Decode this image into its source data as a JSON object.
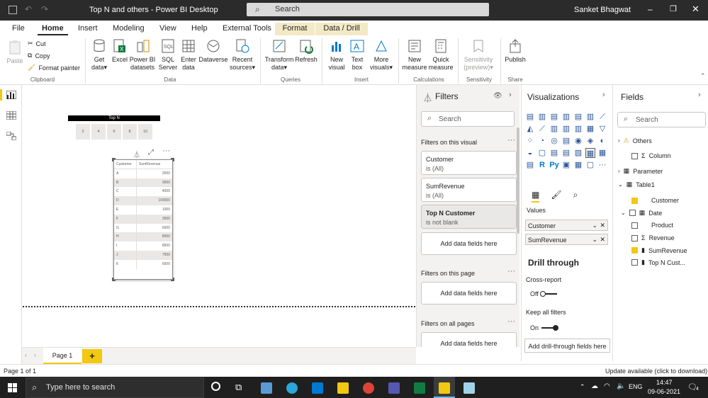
{
  "window": {
    "title": "Top N and others - Power BI Desktop",
    "search_placeholder": "Search",
    "user": "Sanket Bhagwat"
  },
  "tabs": [
    "File",
    "Home",
    "Insert",
    "Modeling",
    "View",
    "Help",
    "External Tools",
    "Format",
    "Data / Drill"
  ],
  "ribbon": {
    "clipboard": {
      "paste": "Paste",
      "cut": "Cut",
      "copy": "Copy",
      "format_painter": "Format painter",
      "label": "Clipboard"
    },
    "data": {
      "get_data": "Get data",
      "excel": "Excel",
      "pbi_datasets": "Power BI datasets",
      "sql": "SQL Server",
      "enter": "Enter data",
      "dataverse": "Dataverse",
      "recent": "Recent sources",
      "label": "Data"
    },
    "queries": {
      "transform": "Transform data",
      "refresh": "Refresh",
      "label": "Queries"
    },
    "insert": {
      "new_visual": "New visual",
      "text_box": "Text box",
      "more_visuals": "More visuals",
      "label": "Insert"
    },
    "calculations": {
      "new_measure": "New measure",
      "quick_measure": "Quick measure",
      "label": "Calculations"
    },
    "sensitivity": {
      "btn": "Sensitivity (preview)",
      "label": "Sensitivity"
    },
    "share": {
      "publish": "Publish",
      "label": "Share"
    }
  },
  "slicer": {
    "title": "Top N",
    "options": [
      "2",
      "4",
      "6",
      "8",
      "10"
    ]
  },
  "table_visual": {
    "headers": [
      "Customer",
      "SumRevenue"
    ],
    "rows": [
      [
        "A",
        "2000"
      ],
      [
        "B",
        "3000"
      ],
      [
        "C",
        "4000"
      ],
      [
        "D",
        "100000"
      ],
      [
        "E",
        "1000"
      ],
      [
        "F",
        "3500"
      ],
      [
        "G",
        "6000"
      ],
      [
        "H",
        "8000"
      ],
      [
        "I",
        "8500"
      ],
      [
        "J",
        "7500"
      ],
      [
        "K",
        "6500"
      ]
    ]
  },
  "filters": {
    "title": "Filters",
    "search": "Search",
    "on_visual": "Filters on this visual",
    "cards": [
      {
        "name": "Customer",
        "state": "is (All)"
      },
      {
        "name": "SumRevenue",
        "state": "is (All)"
      },
      {
        "name": "Top N Customer",
        "state": "is not blank"
      }
    ],
    "add": "Add data fields here",
    "on_page": "Filters on this page",
    "on_all": "Filters on all pages"
  },
  "viz": {
    "title": "Visualizations",
    "values_label": "Values",
    "wells": [
      "Customer",
      "SumRevenue"
    ],
    "drill_title": "Drill through",
    "cross_report": "Cross-report",
    "off": "Off",
    "keep_all": "Keep all filters",
    "on": "On",
    "add_drill": "Add drill-through fields here"
  },
  "fields": {
    "title": "Fields",
    "search": "Search",
    "items": [
      {
        "label": "Others",
        "level": 0
      },
      {
        "label": "Column",
        "level": 1
      },
      {
        "label": "Parameter",
        "level": 0
      },
      {
        "label": "Table1",
        "level": 0
      },
      {
        "label": "Customer",
        "level": 1
      },
      {
        "label": "Date",
        "level": 1
      },
      {
        "label": "Product",
        "level": 1
      },
      {
        "label": "Revenue",
        "level": 1
      },
      {
        "label": "SumRevenue",
        "level": 1
      },
      {
        "label": "Top N Cust...",
        "level": 1
      }
    ]
  },
  "pages": {
    "page1": "Page 1",
    "add": "+"
  },
  "status": {
    "page": "Page 1 of 1",
    "update": "Update available (click to download)"
  },
  "taskbar": {
    "search": "Type here to search",
    "lang": "ENG",
    "time": "14:47",
    "date": "09-06-2021",
    "notif": "4"
  }
}
